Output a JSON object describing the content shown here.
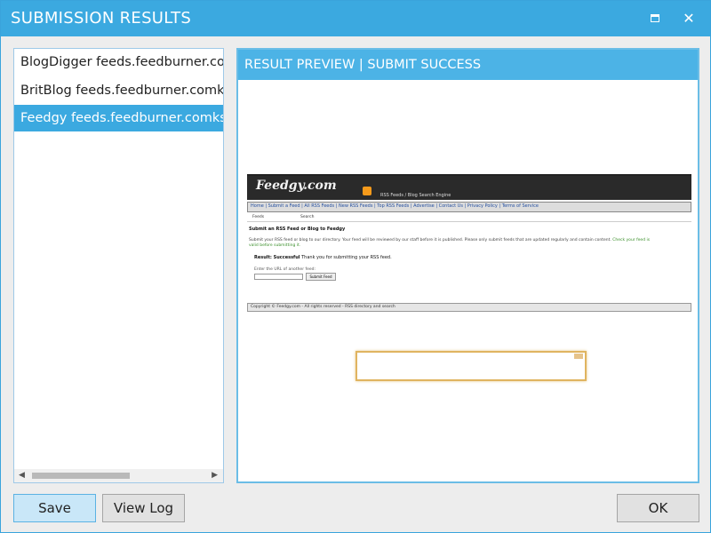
{
  "window": {
    "title": "SUBMISSION RESULTS",
    "maximize_glyph": "",
    "close_glyph": "✕"
  },
  "results_list": {
    "items": [
      {
        "label": "BlogDigger feeds.feedburner.comk"
      },
      {
        "label": "BritBlog feeds.feedburner.comksof"
      },
      {
        "label": "Feedgy feeds.feedburner.comksoft"
      }
    ],
    "selected_index": 2,
    "scroll_left": "◀",
    "scroll_right": "▶"
  },
  "preview": {
    "header": "RESULT PREVIEW | SUBMIT SUCCESS",
    "site": {
      "logo": "Feedgy.com",
      "tagline": "RSS Feeds / Blog Search Engine",
      "nav": "Home | Submit a Feed | All RSS Feeds | New RSS Feeds | Top RSS Feeds | Advertise | Contact Us | Privacy Policy | Terms of Service",
      "row_a": "Feeds",
      "row_b": "Search",
      "heading": "Submit an RSS Feed or Blog to Feedgy",
      "paragraph": "Submit your RSS feed or blog to our directory. Your feed will be reviewed by our staff before it is published. Please only submit feeds that are updated regularly and contain content.",
      "paragraph_green": "Check your feed is valid before submitting it.",
      "submit_label": "Result: Successful",
      "submit_text": "Thank you for submitting your RSS feed.",
      "small_label": "Enter the URL of another feed:",
      "button": "Submit Feed",
      "footer": "Copyright © Feedgy.com - All rights reserved - RSS directory and search"
    }
  },
  "buttons": {
    "save": "Save",
    "view_log": "View Log",
    "ok": "OK"
  },
  "colors": {
    "accent": "#3ba9e0",
    "popup_border": "#e0b460"
  }
}
